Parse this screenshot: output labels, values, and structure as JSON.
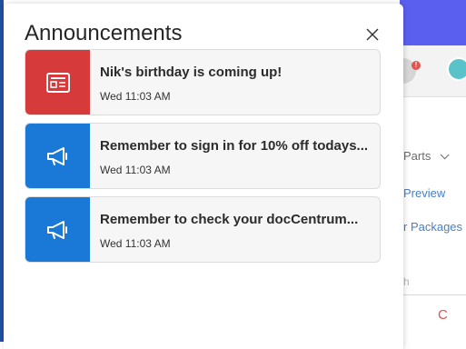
{
  "panel": {
    "title": "Announcements",
    "close_icon": "close-icon"
  },
  "announcements": [
    {
      "title": "Nik's birthday is coming up!",
      "time": "Wed 11:03 AM",
      "icon": "newspaper-icon",
      "color": "#d63a3a"
    },
    {
      "title": "Remember to sign in for 10% off todays...",
      "time": "Wed 11:03 AM",
      "icon": "megaphone-icon",
      "color": "#1a78d6"
    },
    {
      "title": "Remember to check your docCentrum...",
      "time": "Wed 11:03 AM",
      "icon": "megaphone-icon",
      "color": "#1a78d6"
    }
  ],
  "background": {
    "notification_badge": "!",
    "menu": {
      "parts": "Parts",
      "preview": "Preview",
      "packages": "r Packages"
    },
    "search_fragment": "h",
    "red_letter": "C"
  }
}
